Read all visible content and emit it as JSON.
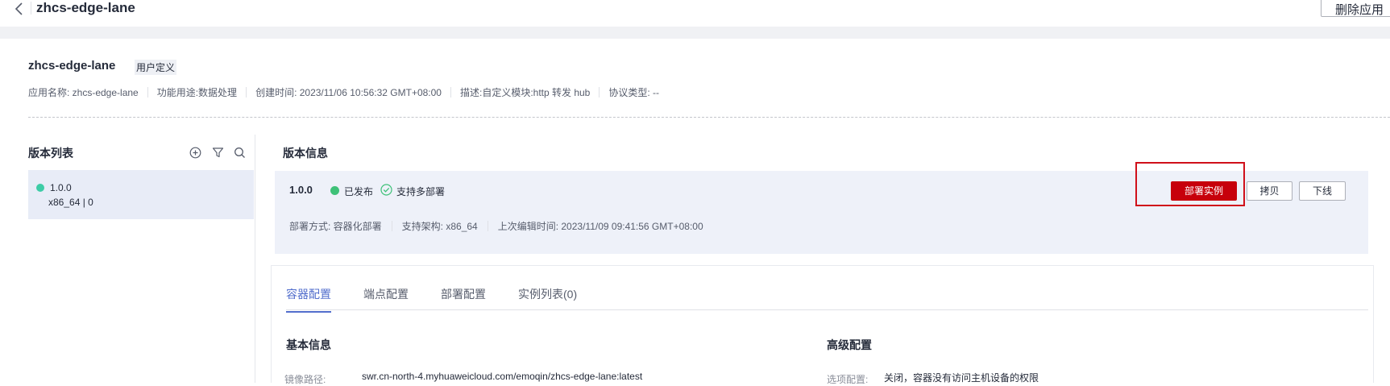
{
  "header": {
    "title": "zhcs-edge-lane",
    "delete_label": "删除应用"
  },
  "app": {
    "name": "zhcs-edge-lane",
    "tag": "用户定义",
    "meta": [
      "应用名称: zhcs-edge-lane",
      "功能用途:数据处理",
      "创建时间: 2023/11/06 10:56:32 GMT+08:00",
      "描述:自定义模块:http 转发 hub",
      "协议类型: --"
    ]
  },
  "version_list": {
    "title": "版本列表",
    "items": [
      {
        "version": "1.0.0",
        "sub": "x86_64 | 0",
        "status_color": "#3dcca6"
      }
    ]
  },
  "version_info": {
    "title": "版本信息",
    "version": "1.0.0",
    "status": "已发布",
    "multi_deploy": "支持多部署",
    "deploy_label": "部署实例",
    "copy_label": "拷贝",
    "offline_label": "下线",
    "details": [
      "部署方式:  容器化部署",
      "支持架构: x86_64",
      "上次编辑时间: 2023/11/09 09:41:56 GMT+08:00"
    ]
  },
  "tabs": [
    {
      "label": "容器配置",
      "active": true
    },
    {
      "label": "端点配置",
      "active": false
    },
    {
      "label": "部署配置",
      "active": false
    },
    {
      "label": "实例列表(0)",
      "active": false
    }
  ],
  "sections": {
    "basic": {
      "title": "基本信息",
      "image_path_label": "镜像路径:",
      "image_path_value": "swr.cn-north-4.myhuaweicloud.com/emoqin/zhcs-edge-lane:latest"
    },
    "advanced": {
      "title": "高级配置",
      "option_label": "选项配置:",
      "option_value": "关闭，容器没有访问主机设备的权限"
    }
  },
  "colors": {
    "brand_red": "#c7000b",
    "tab_active": "#526ecc",
    "success_green": "#3ec178"
  }
}
